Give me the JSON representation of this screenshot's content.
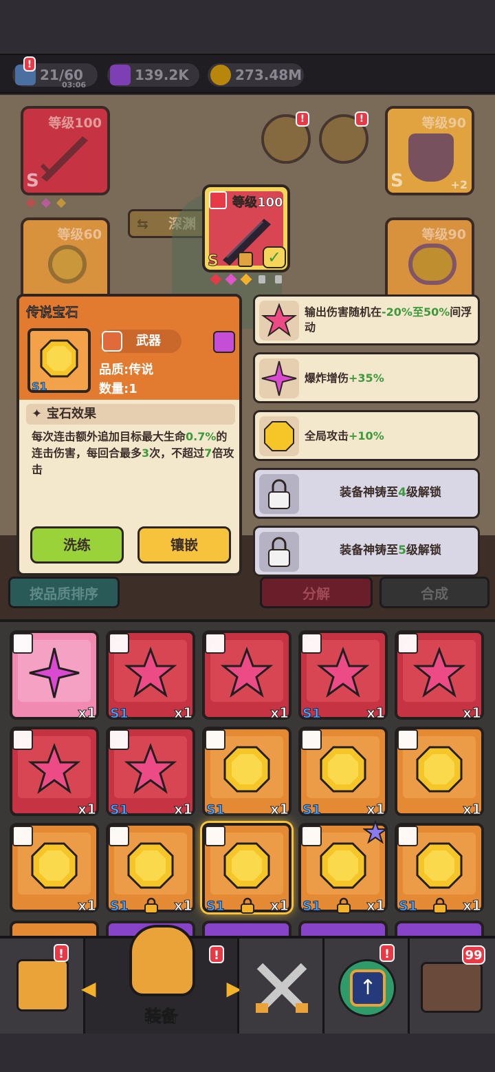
{
  "resources": {
    "energy": "21/60",
    "energy_timer": "03:06",
    "gems": "139.2K",
    "coins": "273.48M"
  },
  "equipment": {
    "weapon_level": "等级100",
    "armor_level": "等级90",
    "ring_level": "等级60",
    "amulet_level": "等级90",
    "armor_plus": "+2",
    "grade": "S",
    "abyss_label": "深渊",
    "selected_level": "等级100"
  },
  "popup": {
    "title": "传说宝石",
    "type_label": "武器",
    "quality": "品质:传说",
    "quantity": "数量:1",
    "effect_header": "宝石效果",
    "effect_prefix": "每次连击额外追加目标最大生命",
    "effect_pct": "0.7%",
    "effect_mid": "的连击伤害，每回合最多",
    "effect_times": "3",
    "effect_mid2": "次，不超过",
    "effect_mult": "7",
    "effect_suffix": "倍攻击",
    "refine_label": "洗练",
    "inlay_label": "镶嵌",
    "badge": "S1"
  },
  "stats": [
    {
      "prefix": "输出伤害随机在",
      "value": "-20%至50%",
      "suffix": "间浮动",
      "icon": "star-gem-icon"
    },
    {
      "prefix": "爆炸增伤",
      "value": "+35%",
      "suffix": "",
      "icon": "spark-gem-icon"
    },
    {
      "prefix": "全局攻击",
      "value": "+10%",
      "suffix": "",
      "icon": "gold-gem-icon"
    },
    {
      "prefix": "装备神铸至",
      "value": "4",
      "suffix": "级解锁",
      "icon": "lock-icon"
    },
    {
      "prefix": "装备神铸至",
      "value": "5",
      "suffix": "级解锁",
      "icon": "lock-icon"
    }
  ],
  "controls": {
    "sort_label": "按品质排序",
    "decompose_label": "分解",
    "synthesize_label": "合成"
  },
  "inventory": [
    {
      "kind": "spark",
      "color": "pink",
      "qty": "x1",
      "s1": "",
      "lock": false
    },
    {
      "kind": "star",
      "color": "red",
      "qty": "x1",
      "s1": "S1",
      "lock": false
    },
    {
      "kind": "star",
      "color": "red",
      "qty": "x1",
      "s1": "",
      "lock": false
    },
    {
      "kind": "star",
      "color": "red",
      "qty": "x1",
      "s1": "S1",
      "lock": false
    },
    {
      "kind": "star",
      "color": "red",
      "qty": "x1",
      "s1": "",
      "lock": false
    },
    {
      "kind": "star",
      "color": "red",
      "qty": "x1",
      "s1": "",
      "lock": false
    },
    {
      "kind": "star",
      "color": "red",
      "qty": "x1",
      "s1": "S1",
      "lock": false
    },
    {
      "kind": "gold",
      "color": "gold",
      "qty": "x1",
      "s1": "S1",
      "lock": false
    },
    {
      "kind": "gold",
      "color": "gold",
      "qty": "x1",
      "s1": "S1",
      "lock": false
    },
    {
      "kind": "gold",
      "color": "gold",
      "qty": "x1",
      "s1": "",
      "lock": false
    },
    {
      "kind": "gold",
      "color": "gold",
      "qty": "x1",
      "s1": "",
      "lock": false
    },
    {
      "kind": "gold",
      "color": "gold",
      "qty": "x1",
      "s1": "S1",
      "lock": true
    },
    {
      "kind": "gold",
      "color": "gold",
      "qty": "x1",
      "s1": "S1",
      "lock": true
    },
    {
      "kind": "gold",
      "color": "gold",
      "qty": "x1",
      "s1": "S1",
      "lock": true
    },
    {
      "kind": "gold",
      "color": "gold",
      "qty": "x1",
      "s1": "S1",
      "lock": true
    }
  ],
  "nav": {
    "active_label": "装备",
    "chest_badge": "99"
  },
  "colors": {
    "accent_green": "#3c9a3c",
    "popup_orange": "#e27a2f",
    "legendary_gold": "#ec9b46",
    "epic_red": "#d84553"
  }
}
